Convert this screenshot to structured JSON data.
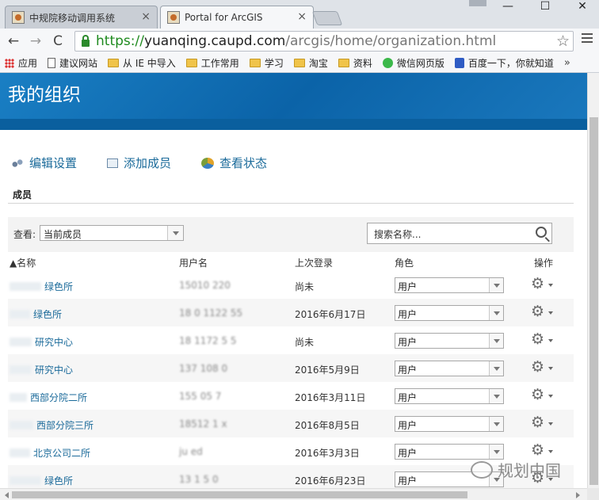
{
  "browser": {
    "tabs": [
      {
        "title": "中规院移动调用系统",
        "close": "×"
      },
      {
        "title": "Portal for ArcGIS",
        "close": "×"
      }
    ],
    "window_controls": {
      "minimize": "—",
      "maximize": "☐",
      "close": "✕"
    },
    "nav": {
      "back": "←",
      "forward": "→",
      "reload": "C"
    },
    "url": {
      "scheme": "https://",
      "host": "yuanqing.caupd.com",
      "path": "/arcgis/home/organization.html"
    },
    "star": "☆",
    "bookmarks": [
      {
        "label": "应用",
        "icon": "apps-icon"
      },
      {
        "label": "建议网站",
        "icon": "page-icon"
      },
      {
        "label": "从 IE 中导入",
        "icon": "folder-icon"
      },
      {
        "label": "工作常用",
        "icon": "folder-icon"
      },
      {
        "label": "学习",
        "icon": "folder-icon"
      },
      {
        "label": "淘宝",
        "icon": "folder-icon"
      },
      {
        "label": "资料",
        "icon": "folder-icon"
      },
      {
        "label": "微信网页版",
        "icon": "wechat-icon"
      },
      {
        "label": "百度一下，你就知道",
        "icon": "baidu-icon"
      }
    ],
    "bookmarks_more": "»"
  },
  "page": {
    "title": "我的组织",
    "actions": [
      {
        "label": "编辑设置",
        "icon": "settings-icon"
      },
      {
        "label": "添加成员",
        "icon": "add-member-icon"
      },
      {
        "label": "查看状态",
        "icon": "status-chart-icon"
      }
    ],
    "section_title": "成员",
    "filter": {
      "label": "查看:",
      "selected": "当前成员"
    },
    "search": {
      "placeholder": "搜索名称..."
    },
    "columns": {
      "name": "▲名称",
      "username": "用户名",
      "last_login": "上次登录",
      "role": "角色",
      "ops": "操作"
    },
    "members": [
      {
        "name": "绿色所",
        "username": "15010 220",
        "last_login": "尚未",
        "role": "用户"
      },
      {
        "name": "绿色所",
        "username": "18 0 1122 55",
        "last_login": "2016年6月17日",
        "role": "用户"
      },
      {
        "name": "研究中心",
        "username": "18 1172 5 5",
        "last_login": "尚未",
        "role": "用户"
      },
      {
        "name": "研究中心",
        "username": "137 108 0",
        "last_login": "2016年5月9日",
        "role": "用户"
      },
      {
        "name": "西部分院二所",
        "username": "155 05 7",
        "last_login": "2016年3月11日",
        "role": "用户"
      },
      {
        "name": "西部分院三所",
        "username": "18512 1 x",
        "last_login": "2016年8月5日",
        "role": "用户"
      },
      {
        "name": "北京公司二所",
        "username": "ju ed",
        "last_login": "2016年3月3日",
        "role": "用户"
      },
      {
        "name": "绿色所",
        "username": "13 1 5 0",
        "last_login": "2016年6月23日",
        "role": "用户"
      }
    ]
  },
  "watermark": "规划中国"
}
